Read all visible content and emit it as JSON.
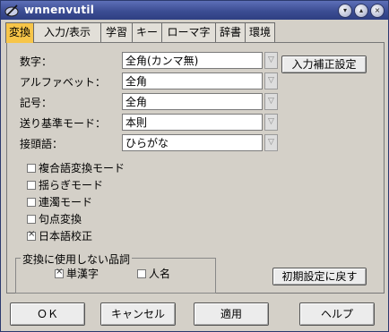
{
  "window": {
    "title": "wnnenvutil"
  },
  "tabs": [
    {
      "label": "変換",
      "active": true
    },
    {
      "label": "入力/表示",
      "active": false
    },
    {
      "label": "学習",
      "active": false
    },
    {
      "label": "キー",
      "active": false
    },
    {
      "label": "ローマ字",
      "active": false
    },
    {
      "label": "辞書",
      "active": false
    },
    {
      "label": "環境",
      "active": false
    }
  ],
  "form": {
    "rows": [
      {
        "label": "数字：",
        "value": "全角(カンマ無)"
      },
      {
        "label": "アルファベット：",
        "value": "全角"
      },
      {
        "label": "記号：",
        "value": "全角"
      },
      {
        "label": "送り基準モード：",
        "value": "本則"
      },
      {
        "label": "接頭語：",
        "value": "ひらがな"
      }
    ],
    "input_correction_button": "入力補正設定"
  },
  "checkboxes": [
    {
      "label": "複合語変換モード",
      "checked": false
    },
    {
      "label": "揺らぎモード",
      "checked": false
    },
    {
      "label": "連濁モード",
      "checked": false
    },
    {
      "label": "句点変換",
      "checked": false
    },
    {
      "label": "日本語校正",
      "checked": true
    }
  ],
  "unused_pos_group": {
    "title": "変換に使用しない品詞",
    "items": [
      {
        "label": "単漢字",
        "checked": true
      },
      {
        "label": "人名",
        "checked": false
      }
    ]
  },
  "reset_button": "初期設定に戻す",
  "footer": {
    "ok": "ＯＫ",
    "cancel": "キャンセル",
    "apply": "適用",
    "help": "ヘルプ"
  },
  "colors": {
    "active_tab": "#f7c548",
    "titlebar": "#3c4d93"
  }
}
